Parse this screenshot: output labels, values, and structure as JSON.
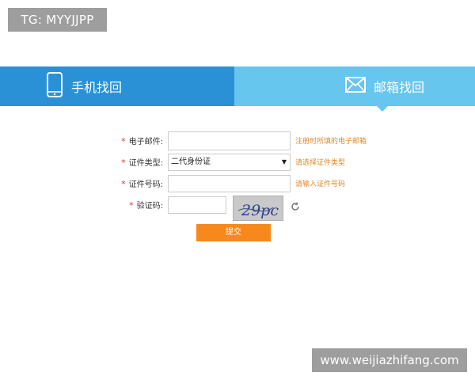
{
  "watermarks": {
    "top": "TG: MYYJJPP",
    "bottom": "www.weijiazhifang.com"
  },
  "tabs": [
    {
      "label": "手机找回",
      "icon": "phone-icon",
      "active": false
    },
    {
      "label": "邮箱找回",
      "icon": "mail-icon",
      "active": true
    }
  ],
  "form": {
    "required_mark": "*",
    "email": {
      "label": "电子邮件:",
      "value": "",
      "hint": "注册时所填的电子邮箱"
    },
    "id_type": {
      "label": "证件类型:",
      "selected": "二代身份证",
      "hint": "请选择证件类型"
    },
    "id_number": {
      "label": "证件号码:",
      "value": "",
      "hint": "请输入证件号码"
    },
    "captcha": {
      "label": "验证码:",
      "value": "",
      "image_text": "29pc"
    },
    "submit_label": "提交"
  },
  "colors": {
    "tab_active_dark": "#2a91d7",
    "tab_light": "#66c6ee",
    "hint": "#e08a2a",
    "submit": "#f7891c",
    "required": "#d73a3a"
  }
}
